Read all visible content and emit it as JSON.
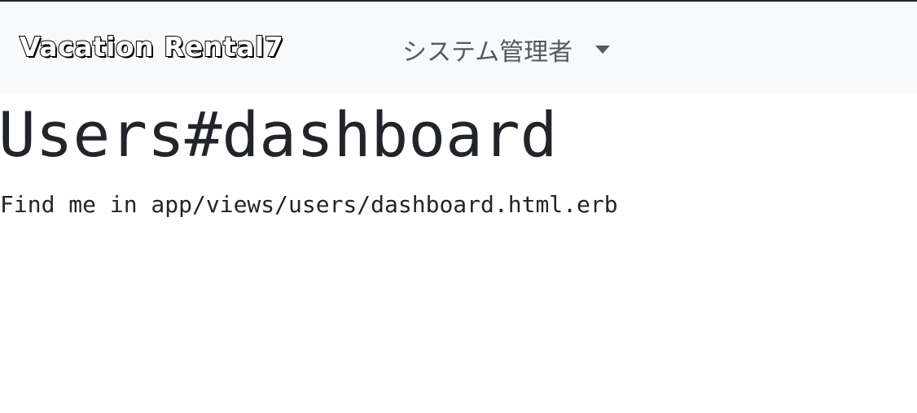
{
  "navbar": {
    "brand": "Vacation Rental7",
    "user_menu_label": "システム管理者",
    "user_menu_icon": "caret-down-icon"
  },
  "main": {
    "title": "Users#dashboard",
    "note": "Find me in app/views/users/dashboard.html.erb"
  },
  "colors": {
    "navbar_bg": "#f8f9fa",
    "text": "#212529",
    "nav_text": "#55595c"
  }
}
